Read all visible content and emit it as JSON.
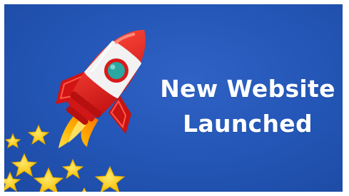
{
  "banner": {
    "headline_line1": "New Website",
    "headline_line2": "Launched",
    "background_color": "#2457b8",
    "text_color": "#ffffff"
  },
  "illustration": {
    "rocket_body_color": "#e21c1c",
    "rocket_nose_color": "#f0f0f0",
    "porthole_color": "#2aa7a0",
    "flame_color": "#ffb300",
    "star_color": "#ffd21f"
  }
}
